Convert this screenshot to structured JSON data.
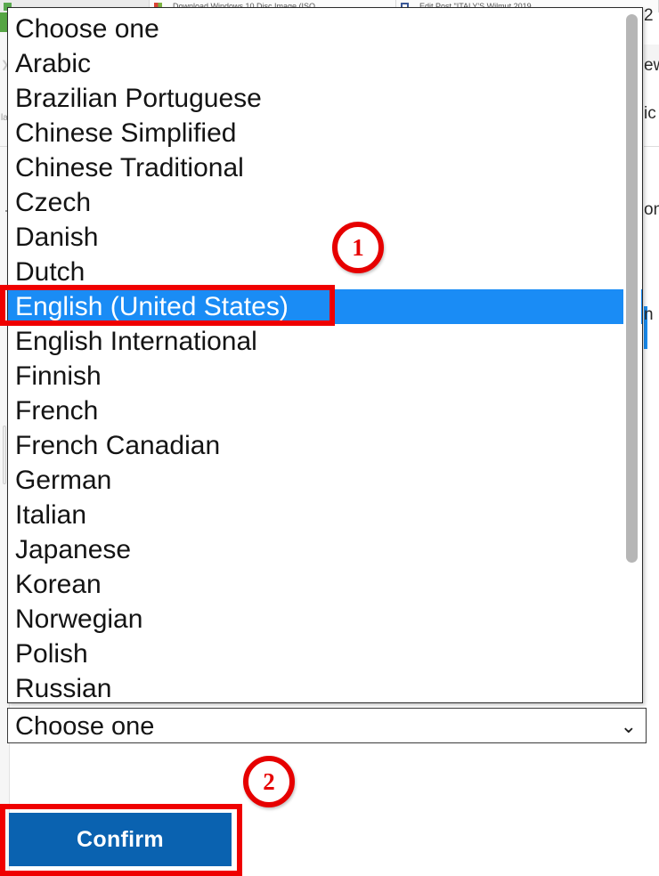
{
  "background": {
    "browser_tabs": [
      {
        "label": "",
        "favicon": "green-app-icon"
      },
      {
        "label": "Download Windows 10 Disc Image (ISO ...",
        "favicon": "multicolor-icon"
      },
      {
        "label": "Edit Post \"ITALY'S Wilmut 2019 ...",
        "favicon": "blue-document-icon"
      }
    ],
    "left_sidebar_fragment": "la",
    "right_fragments": [
      {
        "text": "2"
      },
      {
        "text": "ew"
      },
      {
        "text": "ic"
      },
      {
        "text": "on"
      },
      {
        "text": "n"
      }
    ]
  },
  "dropdown": {
    "name": "language-select-popup",
    "options": [
      "Choose one",
      "Arabic",
      "Brazilian Portuguese",
      "Chinese Simplified",
      "Chinese Traditional",
      "Czech",
      "Danish",
      "Dutch",
      "English (United States)",
      "English International",
      "Finnish",
      "French",
      "French Canadian",
      "German",
      "Italian",
      "Japanese",
      "Korean",
      "Norwegian",
      "Polish",
      "Russian"
    ],
    "selected_index": 8,
    "selected_value": "English (United States)",
    "highlight_color": "#1a8cf5"
  },
  "combo": {
    "name": "language-combobox",
    "value": "Choose one",
    "placeholder": "Choose one",
    "arrow_glyph": "⌄"
  },
  "confirm": {
    "label": "Confirm",
    "color": "#0a62b0"
  },
  "annotations": {
    "accent_color": "#ef0000",
    "steps": [
      {
        "number": "1",
        "target": "English (United States)"
      },
      {
        "number": "2",
        "target": "Confirm"
      }
    ]
  }
}
